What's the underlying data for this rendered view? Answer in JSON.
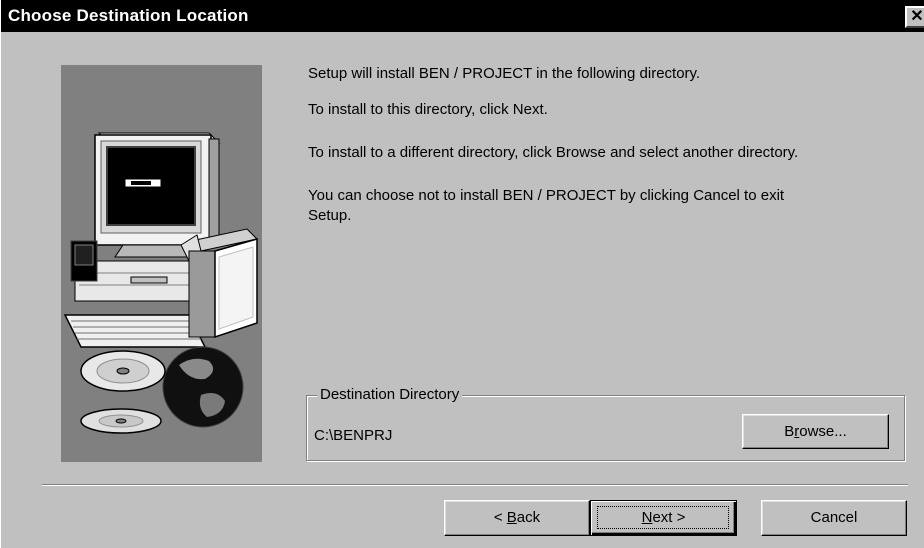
{
  "window": {
    "title": "Choose Destination Location",
    "close_label": "✕"
  },
  "body": {
    "line1": "Setup will install BEN / PROJECT in the following directory.",
    "line2": "To install to this directory, click Next.",
    "line3": "To install to a different directory, click Browse and select another directory.",
    "line4a": "You can choose not to install BEN / PROJECT by clicking Cancel to exit",
    "line4b": "Setup."
  },
  "destination": {
    "group_label": "Destination Directory",
    "path": "C:\\BENPRJ",
    "browse_pre": "B",
    "browse_mn": "r",
    "browse_post": "owse..."
  },
  "buttons": {
    "back_pre": "< ",
    "back_mn": "B",
    "back_post": "ack",
    "next_mn": "N",
    "next_post": "ext >",
    "cancel": "Cancel"
  },
  "colors": {
    "dialog_bg": "#c0c0c0",
    "titlebar": "#000000",
    "artwork_bg": "#808080"
  }
}
